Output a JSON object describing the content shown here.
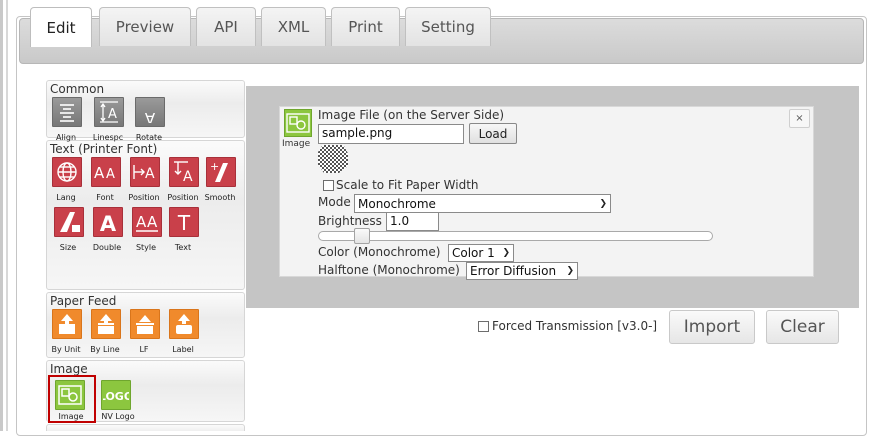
{
  "tabs": [
    {
      "label": "Edit",
      "active": true
    },
    {
      "label": "Preview",
      "active": false
    },
    {
      "label": "API",
      "active": false
    },
    {
      "label": "XML",
      "active": false
    },
    {
      "label": "Print",
      "active": false
    },
    {
      "label": "Setting",
      "active": false
    }
  ],
  "palette": {
    "common": {
      "title": "Common",
      "items": [
        "Align",
        "Linespc",
        "Rotate"
      ]
    },
    "text": {
      "title": "Text (Printer Font)",
      "items": [
        "Lang",
        "Font",
        "Position",
        "Position",
        "Smooth",
        "Size",
        "Double",
        "Style",
        "Text"
      ]
    },
    "paper_feed": {
      "title": "Paper Feed",
      "items": [
        "By Unit",
        "By Line",
        "LF",
        "Label"
      ]
    },
    "image": {
      "title": "Image",
      "items": [
        "Image",
        "NV Logo"
      ],
      "selected": "Image"
    }
  },
  "editor": {
    "item_label": "Image",
    "image_file_label": "Image File (on the Server Side)",
    "image_file_value": "sample.png",
    "load_label": "Load",
    "scale_label": "Scale to Fit Paper Width",
    "scale_checked": false,
    "mode_label": "Mode",
    "mode_value": "Monochrome",
    "brightness_label": "Brightness",
    "brightness_value": "1.0",
    "color_label": "Color (Monochrome)",
    "color_value": "Color 1",
    "halftone_label": "Halftone (Monochrome)",
    "halftone_value": "Error Diffusion",
    "close_glyph": "×"
  },
  "actions": {
    "forced_label": "Forced Transmission [v3.0-]",
    "forced_checked": false,
    "import_label": "Import",
    "clear_label": "Clear"
  },
  "colors": {
    "red_tool": "#c9404a",
    "orange_tool": "#f08a2c",
    "green_tool": "#8cc63f",
    "gray_tool": "#8a8a8a",
    "selected_outline": "#c00000"
  }
}
